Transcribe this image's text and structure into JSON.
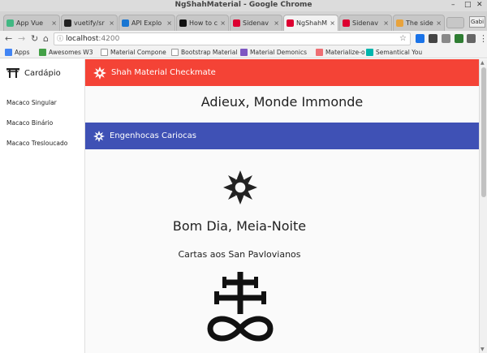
{
  "window": {
    "title": "NgShahMaterial - Google Chrome"
  },
  "tabs": [
    {
      "label": "App Vue",
      "icon": "vue-icon",
      "color": "#41b883"
    },
    {
      "label": "vuetify/sr",
      "icon": "github-icon",
      "color": "#222222"
    },
    {
      "label": "API Explo",
      "icon": "vuetify-icon",
      "color": "#1976d2"
    },
    {
      "label": "How to c",
      "icon": "medium-icon",
      "color": "#111111"
    },
    {
      "label": "Sidenav",
      "icon": "angular-icon",
      "color": "#dd0031"
    },
    {
      "label": "NgShahM",
      "icon": "angular-icon",
      "color": "#dd0031"
    },
    {
      "label": "Sidenav",
      "icon": "angular-icon",
      "color": "#dd0031"
    },
    {
      "label": "The side",
      "icon": "page-icon",
      "color": "#e8a33d"
    }
  ],
  "profile": {
    "label": "Gabi"
  },
  "address": {
    "url_host": "localhost",
    "url_port": ":4200"
  },
  "bookmarks": [
    {
      "label": "Apps",
      "color": "#4285f4"
    },
    {
      "label": "Awesomes W3",
      "color": "#43a047"
    },
    {
      "label": "Material Compone",
      "color": "#ffffff"
    },
    {
      "label": "Bootstrap Material",
      "color": "#ffffff"
    },
    {
      "label": "Material Demonics",
      "color": "#7e57c2"
    },
    {
      "label": "Materialize-o",
      "color": "#ee6e73"
    },
    {
      "label": "Semantical You",
      "color": "#00b5ad"
    }
  ],
  "sidenav": {
    "brand": "Cardápio",
    "items": [
      "Macaco Singular",
      "Macaco Binário",
      "Macaco Tresloucado"
    ]
  },
  "main": {
    "red_bar_title": "Shah Material Checkmate",
    "heading1": "Adieux, Monde Immonde",
    "blue_bar_title": "Engenhocas Cariocas",
    "heading2": "Bom Dia, Meia-Noite",
    "heading3": "Cartas aos San Pavlovianos"
  },
  "colors": {
    "red": "#f44336",
    "blue": "#3f51b5"
  }
}
